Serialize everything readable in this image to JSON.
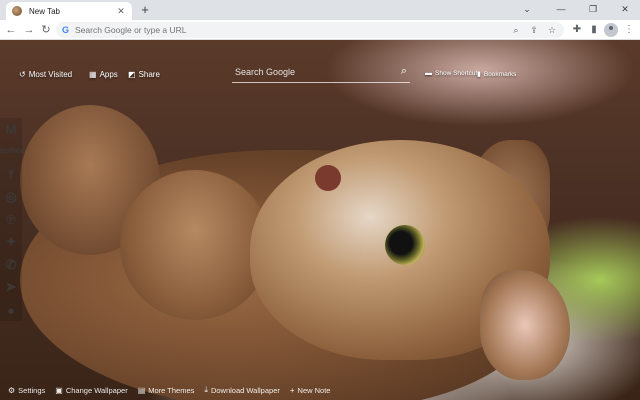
{
  "browser": {
    "tab_title": "New Tab",
    "tab_close": "✕",
    "new_tab": "+",
    "window_controls": [
      "⌄",
      "—",
      "❐",
      "✕"
    ],
    "omnibox_placeholder": "Search Google or type a URL",
    "omnibox_icons": [
      "zoom-icon",
      "share-icon",
      "bookmark-star-icon"
    ],
    "toolbar_icons": [
      "extensions-icon",
      "side-panel-icon",
      "profile-avatar",
      "menu-icon"
    ]
  },
  "page": {
    "top_left_nav": [
      {
        "label": "Most Visited",
        "icon": "history-icon"
      },
      {
        "label": "Apps",
        "icon": "apps-grid-icon"
      },
      {
        "label": "Share",
        "icon": "share-icon"
      }
    ],
    "search_placeholder": "Search Google",
    "top_right_nav": [
      {
        "label": "Show Shortcuts",
        "icon": "shortcuts-icon"
      },
      {
        "label": "Bookmarks",
        "icon": "bookmark-icon"
      }
    ],
    "social_icons": [
      "gmail-icon",
      "youtube-icon",
      "facebook-icon",
      "instagram-icon",
      "pinterest-icon",
      "twitter-icon",
      "whatsapp-icon",
      "telegram-icon",
      "reddit-icon"
    ],
    "youtube_text": "YouTube",
    "bottom_bar": [
      {
        "label": "Settings",
        "icon": "gear-icon"
      },
      {
        "label": "Change Wallpaper",
        "icon": "image-icon"
      },
      {
        "label": "More Themes",
        "icon": "themes-icon"
      },
      {
        "label": "Download Wallpaper",
        "icon": "download-icon"
      },
      {
        "label": "New Note",
        "icon": "plus-icon"
      }
    ]
  }
}
